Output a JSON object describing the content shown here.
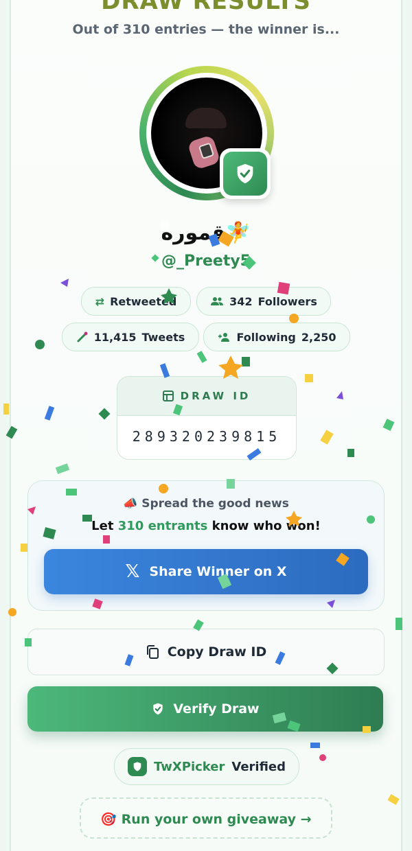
{
  "header": {
    "title": "DRAW RESULTS",
    "subtitle": "Out of 310 entries — the winner is..."
  },
  "winner": {
    "name": "قموره🧚",
    "handle": "@_Preety5"
  },
  "stats": {
    "retweeted_label": "Retweeted",
    "followers_value": "342",
    "followers_label": "Followers",
    "tweets_value": "11,415",
    "tweets_label": "Tweets",
    "following_label": "Following",
    "following_value": "2,250"
  },
  "draw_id": {
    "label": "DRAW ID",
    "value": "289320239815"
  },
  "share": {
    "heading": "📣 Spread the good news",
    "sub_prefix": "Let",
    "sub_highlight": "310 entrants",
    "sub_suffix": "know who won!",
    "button_label": "Share Winner on X"
  },
  "actions": {
    "copy_label": "Copy Draw ID",
    "verify_label": "Verify Draw"
  },
  "brand": {
    "name": "TwXPicker",
    "verified": "Verified"
  },
  "footer": {
    "run_own_label": "🎯 Run your own giveaway →"
  },
  "colors": {
    "accent_green": "#2f8a52",
    "x_blue": "#3b86de",
    "background": "#eef7f1"
  }
}
